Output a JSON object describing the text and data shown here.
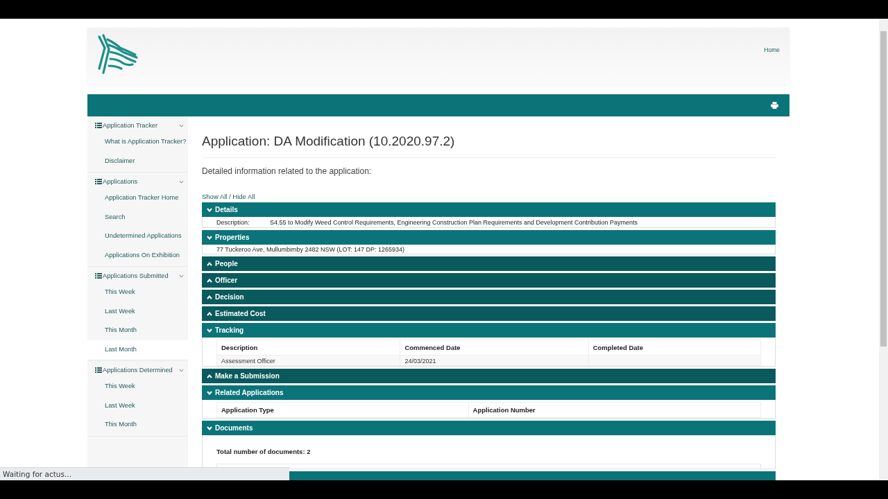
{
  "header": {
    "nav_link": "Home"
  },
  "sidebar": {
    "groups": [
      {
        "title": "Application Tracker",
        "expanded": true,
        "items": [
          {
            "label": "What is Application Tracker?",
            "selected": false
          },
          {
            "label": "Disclaimer",
            "selected": false
          }
        ]
      },
      {
        "title": "Applications",
        "expanded": true,
        "items": [
          {
            "label": "Application Tracker Home",
            "selected": false
          },
          {
            "label": "Search",
            "selected": false
          },
          {
            "label": "Undetermined Applications",
            "selected": false
          },
          {
            "label": "Applications On Exhibition",
            "selected": false
          }
        ]
      },
      {
        "title": "Applications Submitted",
        "expanded": true,
        "items": [
          {
            "label": "This Week",
            "selected": false
          },
          {
            "label": "Last Week",
            "selected": false
          },
          {
            "label": "This Month",
            "selected": false
          },
          {
            "label": "Last Month",
            "selected": true
          }
        ]
      },
      {
        "title": "Applications Determined",
        "expanded": true,
        "items": [
          {
            "label": "This Week",
            "selected": false
          },
          {
            "label": "Last Week",
            "selected": false
          },
          {
            "label": "This Month",
            "selected": false
          }
        ]
      }
    ]
  },
  "content": {
    "title": "Application: DA Modification (10.2020.97.2)",
    "intro": "Detailed information related to the application:",
    "toggle_link": "Show All / Hide All",
    "sections": [
      {
        "title": "Details",
        "expanded": true,
        "kind": "fields",
        "fields": [
          {
            "label": "Description:",
            "value": "S4.55 to Modify Weed Control Requirements, Engineering Construction Plan Requirements and Development Contribution Payments"
          }
        ]
      },
      {
        "title": "Properties",
        "expanded": true,
        "kind": "lines",
        "lines": [
          "77 Tuckeroo Ave, Mullumbimby 2482 NSW (LOT: 147 DP: 1265934)"
        ]
      },
      {
        "title": "People",
        "expanded": false
      },
      {
        "title": "Officer",
        "expanded": false
      },
      {
        "title": "Decision",
        "expanded": false
      },
      {
        "title": "Estimated Cost",
        "expanded": false
      },
      {
        "title": "Tracking",
        "expanded": true,
        "kind": "table",
        "columns": [
          "Description",
          "Commenced Date",
          "Completed Date"
        ],
        "rows": [
          [
            "Assessment Officer",
            "24/03/2021"
          ]
        ]
      },
      {
        "title": "Make a Submission",
        "expanded": false
      },
      {
        "title": "Related Applications",
        "expanded": true,
        "kind": "table",
        "columns": [
          "Application Type",
          "Application Number"
        ]
      },
      {
        "title": "Documents",
        "expanded": true,
        "kind": "documents",
        "summary": "Total number of documents: 2"
      }
    ]
  },
  "status_bar": {
    "text": "Waiting for actus..."
  }
}
